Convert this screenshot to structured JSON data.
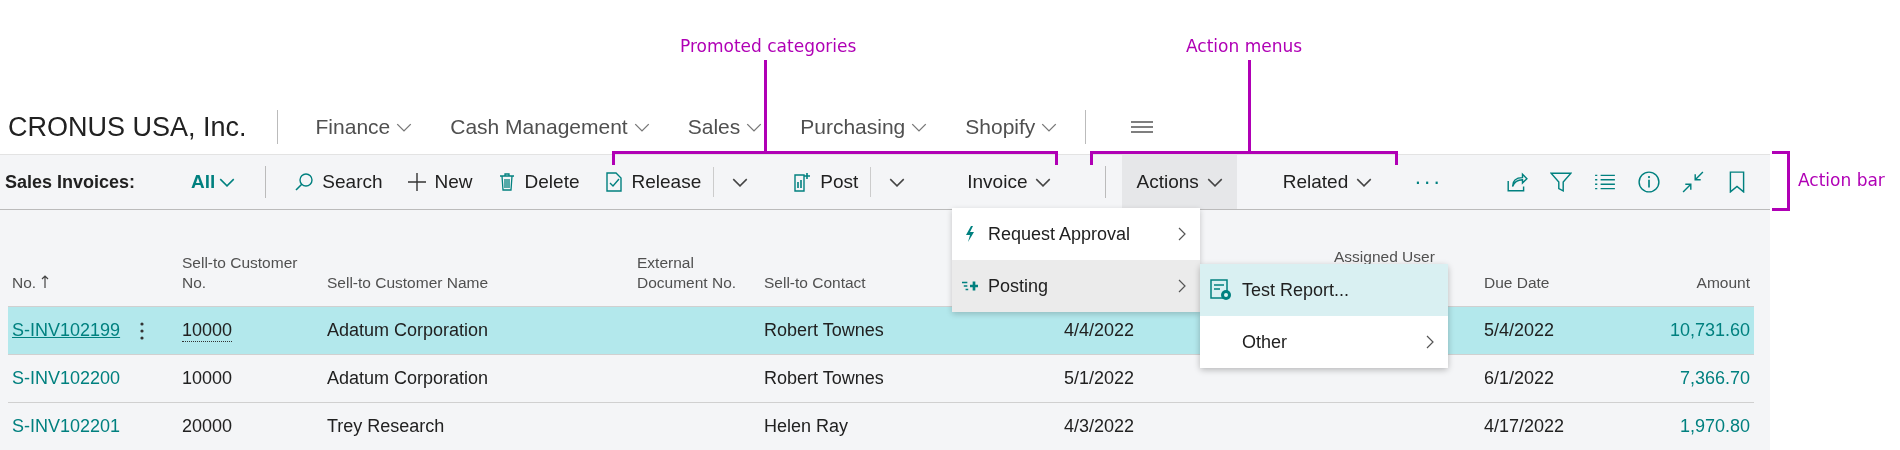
{
  "annotations": [
    {
      "label": "Promoted categories"
    },
    {
      "label": "Action menus"
    },
    {
      "label": "Action bar"
    }
  ],
  "company": "CRONUS USA, Inc.",
  "nav": [
    {
      "label": "Finance"
    },
    {
      "label": "Cash Management"
    },
    {
      "label": "Sales"
    },
    {
      "label": "Purchasing"
    },
    {
      "label": "Shopify"
    }
  ],
  "action_bar": {
    "page_title": "Sales Invoices:",
    "view": "All",
    "actions": [
      {
        "kind": "button",
        "label": "Search"
      },
      {
        "kind": "button",
        "label": "New"
      },
      {
        "kind": "button",
        "label": "Delete"
      },
      {
        "kind": "split",
        "label": "Release"
      },
      {
        "kind": "split",
        "label": "Post"
      },
      {
        "kind": "menu",
        "label": "Invoice",
        "selected": false
      },
      {
        "kind": "menu",
        "label": "Actions",
        "selected": true
      },
      {
        "kind": "menu",
        "label": "Related",
        "selected": false
      },
      {
        "kind": "more",
        "label": "···"
      }
    ]
  },
  "table": {
    "columns": [
      "No.",
      "Sell-to Customer No.",
      "Sell-to Customer Name",
      "External Document No.",
      "Sell-to Contact",
      null,
      "Assigned User",
      "Due Date",
      "Amount"
    ],
    "rows": [
      {
        "selected": true,
        "cells": [
          "S-INV102199",
          "10000",
          "Adatum Corporation",
          null,
          "Robert Townes",
          "4/4/2022",
          null,
          "5/4/2022",
          "10,731.60"
        ]
      },
      {
        "selected": false,
        "cells": [
          "S-INV102200",
          "10000",
          "Adatum Corporation",
          null,
          "Robert Townes",
          "5/1/2022",
          null,
          "6/1/2022",
          "7,366.70"
        ]
      },
      {
        "selected": false,
        "cells": [
          "S-INV102201",
          "20000",
          "Trey Research",
          null,
          "Helen Ray",
          "4/3/2022",
          null,
          "4/17/2022",
          "1,970.80"
        ]
      }
    ]
  },
  "actions_menu": {
    "items": [
      {
        "label": "Request Approval",
        "selected": false
      },
      {
        "label": "Posting",
        "selected": true
      }
    ]
  },
  "posting_submenu": {
    "items": [
      {
        "label": "Test Report...",
        "selected": true,
        "has_submenu": false
      },
      {
        "label": "Other",
        "selected": false,
        "has_submenu": true
      }
    ]
  }
}
